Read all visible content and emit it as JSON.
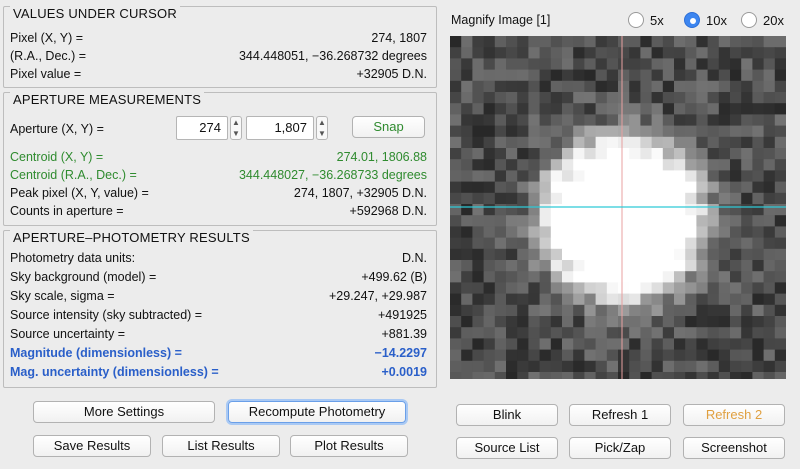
{
  "values_under_cursor": {
    "title": "VALUES UNDER CURSOR",
    "rows": [
      {
        "label": "Pixel (X, Y) =",
        "value": "274, 1807"
      },
      {
        "label": "(R.A., Dec.) =",
        "value": "344.448051, −36.268732 degrees"
      },
      {
        "label": "Pixel value =",
        "value": "+32905 D.N."
      }
    ]
  },
  "aperture_measurements": {
    "title": "APERTURE MEASUREMENTS",
    "aperture_label": "Aperture (X, Y) =",
    "aperture_x": "274",
    "aperture_y": "1,807",
    "snap_label": "Snap",
    "rows": [
      {
        "label": "Centroid (X, Y) =",
        "value": "274.01, 1806.88"
      },
      {
        "label": "Centroid (R.A., Dec.) =",
        "value": "344.448027, −36.268733 degrees"
      },
      {
        "label": "Peak pixel (X, Y, value) =",
        "value": "274, 1807, +32905 D.N."
      },
      {
        "label": "Counts in aperture =",
        "value": "+592968 D.N."
      }
    ]
  },
  "photometry_results": {
    "title": "APERTURE–PHOTOMETRY RESULTS",
    "rows": [
      {
        "label": "Photometry data units:",
        "value": "D.N."
      },
      {
        "label": "Sky background (model) =",
        "value": "+499.62 (B)"
      },
      {
        "label": "Sky scale, sigma =",
        "value": "+29.247, +29.987"
      },
      {
        "label": "Source intensity (sky subtracted)  =",
        "value": "+491925"
      },
      {
        "label": "Source uncertainty =",
        "value": "+881.39"
      },
      {
        "label": "Magnitude (dimensionless) =",
        "value": "−14.2297"
      },
      {
        "label": "Mag. uncertainty (dimensionless) =",
        "value": "+0.0019"
      }
    ]
  },
  "left_buttons": {
    "more_settings": "More Settings",
    "recompute": "Recompute Photometry",
    "save_results": "Save Results",
    "list_results": "List Results",
    "plot_results": "Plot Results"
  },
  "magnify": {
    "label": "Magnify Image [1]",
    "options": [
      "5x",
      "10x",
      "20x"
    ],
    "selected": "10x",
    "cursor_line_color": "#e8a0a0",
    "horizontal_line_color": "#2ec9d6"
  },
  "right_buttons": {
    "blink": "Blink",
    "refresh1": "Refresh 1",
    "refresh2": "Refresh 2",
    "source_list": "Source List",
    "pick_zap": "Pick/Zap",
    "screenshot": "Screenshot"
  },
  "colors": {
    "green_text": "#2f8b2f",
    "blue_text": "#2a5fc9",
    "orange_text": "#e0a040",
    "focus_ring": "#a9c9f4"
  }
}
